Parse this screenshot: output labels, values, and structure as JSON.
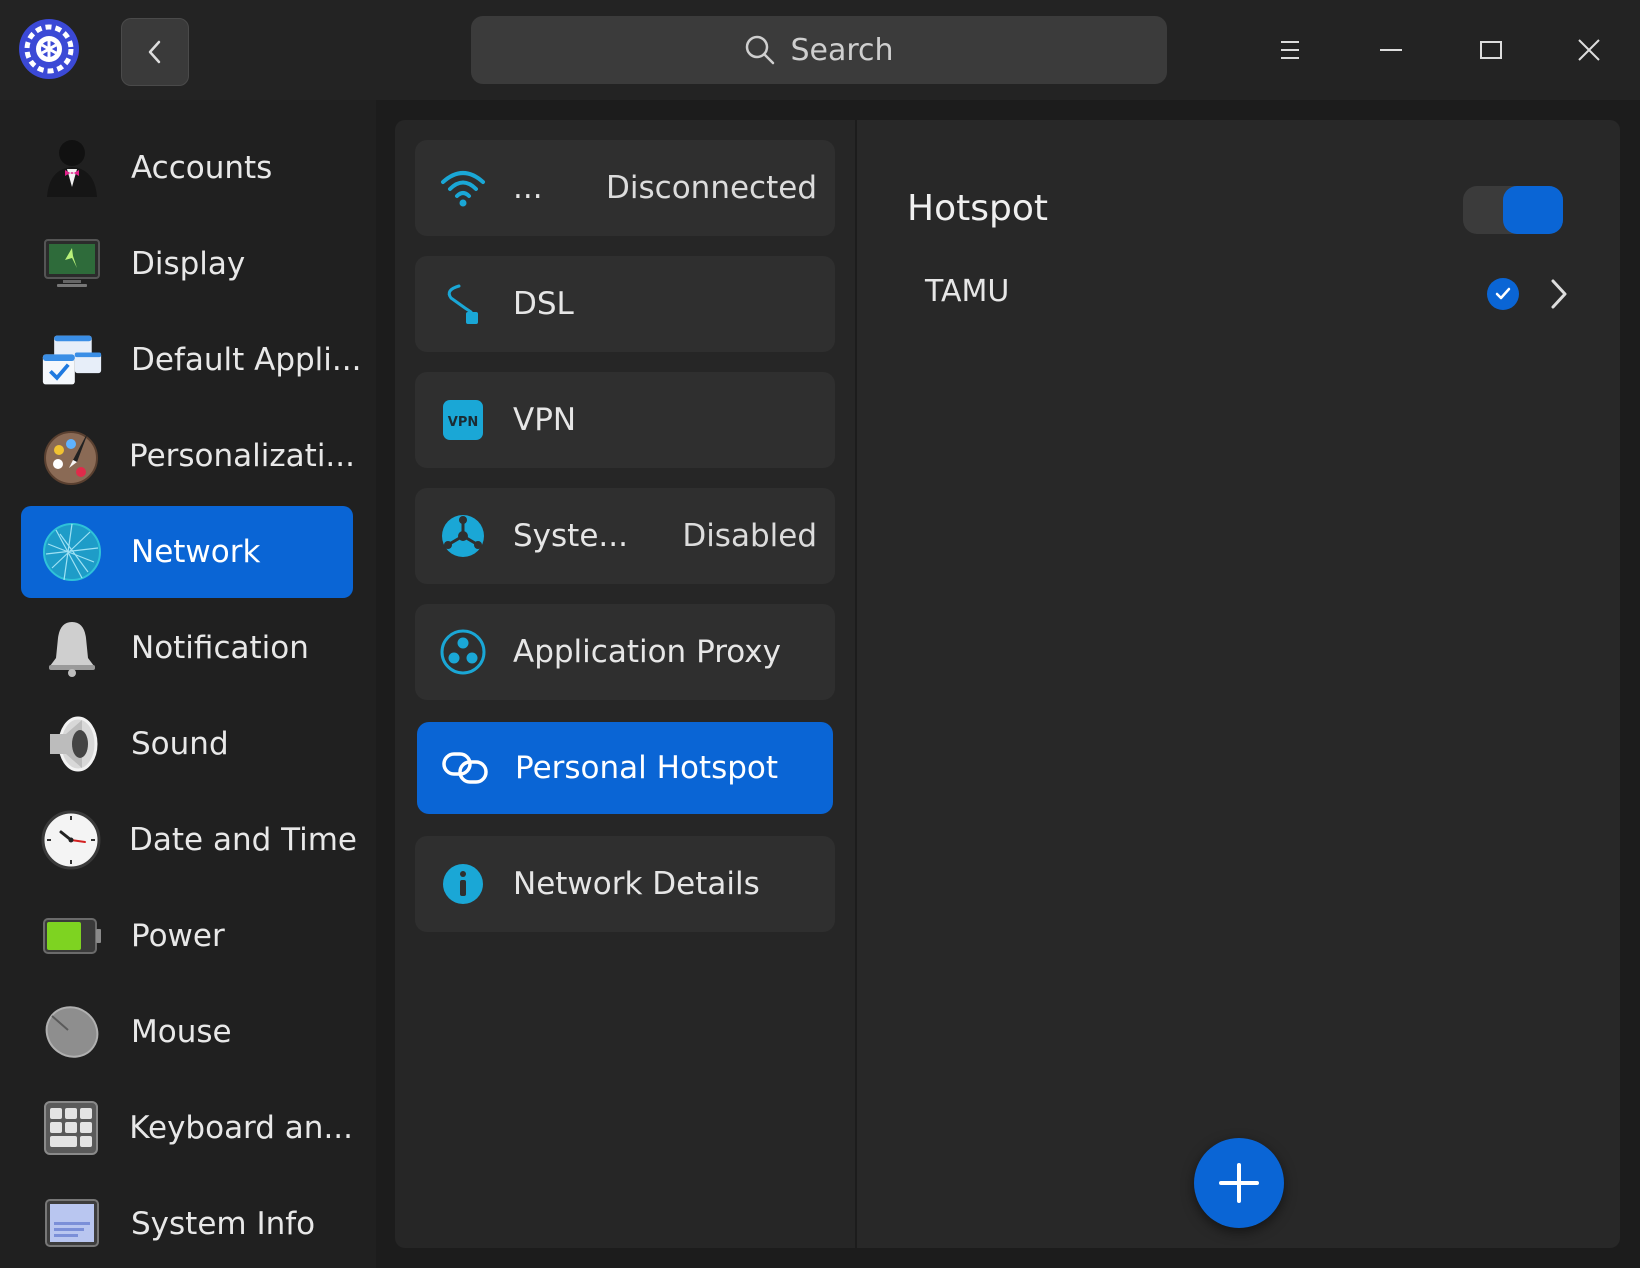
{
  "header": {
    "search_placeholder": "Search",
    "icons": [
      "settings-logo-icon",
      "back-chevron-icon",
      "search-icon",
      "menu-icon",
      "minimize-icon",
      "maximize-icon",
      "close-icon"
    ]
  },
  "sidebar": {
    "items": [
      {
        "label": "Accounts",
        "icon": "accounts-icon",
        "active": false
      },
      {
        "label": "Display",
        "icon": "display-icon",
        "active": false
      },
      {
        "label": "Default Appli...",
        "icon": "default-apps-icon",
        "active": false
      },
      {
        "label": "Personalizati...",
        "icon": "palette-icon",
        "active": false
      },
      {
        "label": "Network",
        "icon": "network-globe-icon",
        "active": true
      },
      {
        "label": "Notification",
        "icon": "bell-icon",
        "active": false
      },
      {
        "label": "Sound",
        "icon": "speaker-icon",
        "active": false
      },
      {
        "label": "Date and Time",
        "icon": "clock-icon",
        "active": false
      },
      {
        "label": "Power",
        "icon": "battery-icon",
        "active": false
      },
      {
        "label": "Mouse",
        "icon": "mouse-icon",
        "active": false
      },
      {
        "label": "Keyboard an...",
        "icon": "keyboard-icon",
        "active": false
      },
      {
        "label": "System Info",
        "icon": "system-info-icon",
        "active": false
      }
    ]
  },
  "network_menu": {
    "items": [
      {
        "label": "...",
        "status": "Disconnected",
        "icon": "wifi-icon",
        "active": false
      },
      {
        "label": "DSL",
        "status": "",
        "icon": "dsl-cable-icon",
        "active": false
      },
      {
        "label": "VPN",
        "status": "",
        "icon": "vpn-icon",
        "active": false
      },
      {
        "label": "Syste...",
        "status": "Disabled",
        "icon": "system-proxy-icon",
        "active": false
      },
      {
        "label": "Application Proxy",
        "status": "",
        "icon": "app-proxy-icon",
        "active": false
      },
      {
        "label": "Personal Hotspot",
        "status": "",
        "icon": "hotspot-link-icon",
        "active": true
      },
      {
        "label": "Network Details",
        "status": "",
        "icon": "info-icon",
        "active": false
      }
    ]
  },
  "hotspot": {
    "title": "Hotspot",
    "enabled": true,
    "networks": [
      {
        "name": "TAMU",
        "selected": true
      }
    ]
  },
  "colors": {
    "accent": "#0a65d5",
    "icon_cyan": "#1aa7d6",
    "background": "#1c1c1c",
    "panel": "#282828"
  }
}
